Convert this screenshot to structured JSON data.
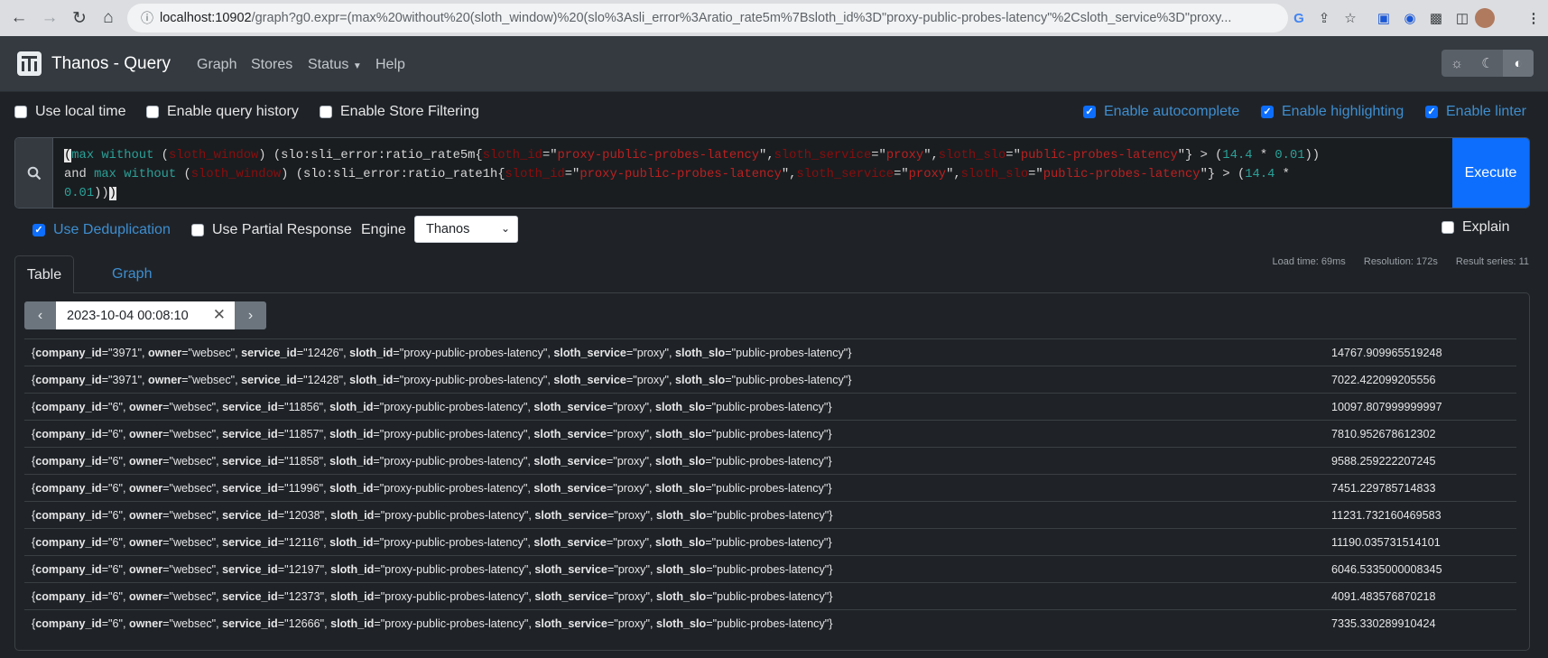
{
  "browser": {
    "url_host": "localhost:10902",
    "url_rest": "/graph?g0.expr=(max%20without%20(sloth_window)%20(slo%3Asli_error%3Aratio_rate5m%7Bsloth_id%3D\"proxy-public-probes-latency\"%2Csloth_service%3D\"proxy..."
  },
  "navbar": {
    "brand": "Thanos - Query",
    "links": [
      "Graph",
      "Stores",
      "Status",
      "Help"
    ]
  },
  "options": {
    "use_local_time": "Use local time",
    "enable_query_history": "Enable query history",
    "enable_store_filtering": "Enable Store Filtering",
    "enable_autocomplete": "Enable autocomplete",
    "enable_highlighting": "Enable highlighting",
    "enable_linter": "Enable linter"
  },
  "query": {
    "execute_label": "Execute",
    "line1": "(max without (sloth_window) (slo:sli_error:ratio_rate5m{sloth_id=\"proxy-public-probes-latency\",sloth_service=\"proxy\",sloth_slo=\"public-probes-latency\"} > (14.4 * 0.01))",
    "line2": "and max without (sloth_window) (slo:sli_error:ratio_rate1h{sloth_id=\"proxy-public-probes-latency\",sloth_service=\"proxy\",sloth_slo=\"public-probes-latency\"} > (14.4 *",
    "line3": "0.01)))"
  },
  "controls": {
    "use_deduplication": "Use Deduplication",
    "use_partial_response": "Use Partial Response",
    "engine_label": "Engine",
    "engine_value": "Thanos",
    "explain": "Explain"
  },
  "tabs": {
    "table": "Table",
    "graph": "Graph"
  },
  "stats": {
    "load_time": "Load time: 69ms",
    "resolution": "Resolution: 172s",
    "result_series": "Result series: 11"
  },
  "time": {
    "value": "2023-10-04 00:08:10"
  },
  "label_names": [
    "company_id",
    "owner",
    "service_id",
    "sloth_id",
    "sloth_service",
    "sloth_slo"
  ],
  "results": [
    {
      "company_id": "3971",
      "owner": "websec",
      "service_id": "12426",
      "sloth_id": "proxy-public-probes-latency",
      "sloth_service": "proxy",
      "sloth_slo": "public-probes-latency",
      "value": "14767.909965519248"
    },
    {
      "company_id": "3971",
      "owner": "websec",
      "service_id": "12428",
      "sloth_id": "proxy-public-probes-latency",
      "sloth_service": "proxy",
      "sloth_slo": "public-probes-latency",
      "value": "7022.422099205556"
    },
    {
      "company_id": "6",
      "owner": "websec",
      "service_id": "11856",
      "sloth_id": "proxy-public-probes-latency",
      "sloth_service": "proxy",
      "sloth_slo": "public-probes-latency",
      "value": "10097.807999999997"
    },
    {
      "company_id": "6",
      "owner": "websec",
      "service_id": "11857",
      "sloth_id": "proxy-public-probes-latency",
      "sloth_service": "proxy",
      "sloth_slo": "public-probes-latency",
      "value": "7810.952678612302"
    },
    {
      "company_id": "6",
      "owner": "websec",
      "service_id": "11858",
      "sloth_id": "proxy-public-probes-latency",
      "sloth_service": "proxy",
      "sloth_slo": "public-probes-latency",
      "value": "9588.259222207245"
    },
    {
      "company_id": "6",
      "owner": "websec",
      "service_id": "11996",
      "sloth_id": "proxy-public-probes-latency",
      "sloth_service": "proxy",
      "sloth_slo": "public-probes-latency",
      "value": "7451.229785714833"
    },
    {
      "company_id": "6",
      "owner": "websec",
      "service_id": "12038",
      "sloth_id": "proxy-public-probes-latency",
      "sloth_service": "proxy",
      "sloth_slo": "public-probes-latency",
      "value": "11231.732160469583"
    },
    {
      "company_id": "6",
      "owner": "websec",
      "service_id": "12116",
      "sloth_id": "proxy-public-probes-latency",
      "sloth_service": "proxy",
      "sloth_slo": "public-probes-latency",
      "value": "11190.035731514101"
    },
    {
      "company_id": "6",
      "owner": "websec",
      "service_id": "12197",
      "sloth_id": "proxy-public-probes-latency",
      "sloth_service": "proxy",
      "sloth_slo": "public-probes-latency",
      "value": "6046.5335000008345"
    },
    {
      "company_id": "6",
      "owner": "websec",
      "service_id": "12373",
      "sloth_id": "proxy-public-probes-latency",
      "sloth_service": "proxy",
      "sloth_slo": "public-probes-latency",
      "value": "4091.483576870218"
    },
    {
      "company_id": "6",
      "owner": "websec",
      "service_id": "12666",
      "sloth_id": "proxy-public-probes-latency",
      "sloth_service": "proxy",
      "sloth_slo": "public-probes-latency",
      "value": "7335.330289910424"
    }
  ],
  "colors": {
    "accent": "#0d6efd",
    "link": "#3e8ed0",
    "navbar": "#343a40",
    "background": "#1f2328"
  }
}
